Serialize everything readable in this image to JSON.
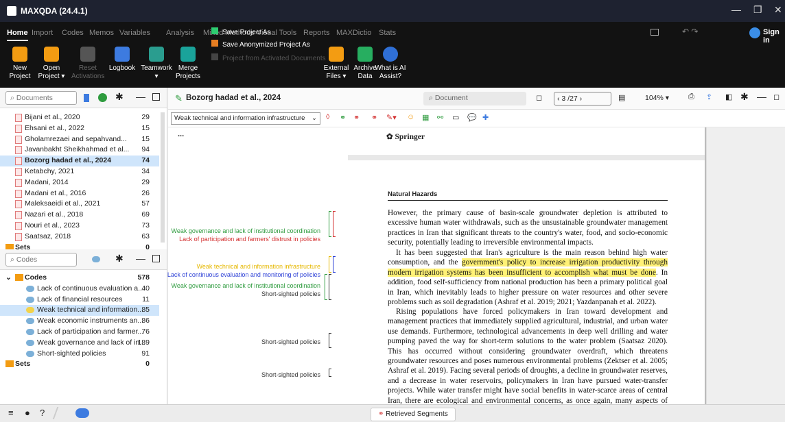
{
  "app": {
    "title": "MAXQDA (24.4.1)",
    "sign_in": "Sign in"
  },
  "menu_tabs": [
    "Home",
    "Import",
    "Codes",
    "Memos",
    "Variables",
    "Analysis",
    "Mixed Methods",
    "Visual Tools",
    "Reports",
    "MAXDictio",
    "Stats"
  ],
  "ribbon": {
    "new": "New\nProject",
    "open": "Open\nProject ▾",
    "reset": "Reset\nActivations",
    "logbook": "Logbook",
    "teamwork": "Teamwork\n▾",
    "merge": "Merge\nProjects",
    "save_as": "Save Project As",
    "save_anon": "Save Anonymized Project As",
    "from_activated": "Project from Activated Documents",
    "external": "External\nFiles ▾",
    "archive": "Archive\nData",
    "ai": "What is AI\nAssist?"
  },
  "documents": {
    "search_placeholder": "Documents",
    "items": [
      {
        "label": "Bijani et al., 2020",
        "count": "29"
      },
      {
        "label": "Ehsani et al., 2022",
        "count": "15"
      },
      {
        "label": "Gholamrezaei and sepahvand...",
        "count": "15"
      },
      {
        "label": "Javanbakht Sheikhahmad et al...",
        "count": "94"
      },
      {
        "label": "Bozorg hadad et al., 2024",
        "count": "74"
      },
      {
        "label": "Ketabchy, 2021",
        "count": "34"
      },
      {
        "label": "Madani, 2014",
        "count": "29"
      },
      {
        "label": "Madani et al., 2016",
        "count": "26"
      },
      {
        "label": "Maleksaeidi et al., 2021",
        "count": "57"
      },
      {
        "label": "Nazari et al., 2018",
        "count": "69"
      },
      {
        "label": "Nouri et al., 2023",
        "count": "73"
      },
      {
        "label": "Saatsaz, 2018",
        "count": "63"
      }
    ],
    "sets_label": "Sets",
    "sets_count": "0"
  },
  "codes": {
    "search_placeholder": "Codes",
    "root_label": "Codes",
    "root_count": "578",
    "items": [
      {
        "label": "Lack of continuous evaluation a...",
        "count": "40"
      },
      {
        "label": "Lack of financial resources",
        "count": "11"
      },
      {
        "label": "Weak technical and information...",
        "count": "85"
      },
      {
        "label": "Weak economic instruments an...",
        "count": "86"
      },
      {
        "label": "Lack of participation and farmer...",
        "count": "76"
      },
      {
        "label": "Weak governance and lack of in...",
        "count": "189"
      },
      {
        "label": "Short-sighted policies",
        "count": "91"
      }
    ],
    "sets_label": "Sets",
    "sets_count": "0"
  },
  "document_browser": {
    "title": "Bozorg hadad et al., 2024",
    "search_placeholder": "Document",
    "page_indicator": "3 /27",
    "zoom": "104% ▾",
    "code_dropdown": "Weak technical and information infrastructure",
    "ellipsis": "..."
  },
  "margin_codes": [
    {
      "label": "Weak governance and lack of institutional coordination",
      "color": "#2e9b3e"
    },
    {
      "label": "Lack of participation and farmers' distrust in policies",
      "color": "#d32f2f"
    },
    {
      "label": "Weak technical and information infrastructure",
      "color": "#e6b800"
    },
    {
      "label": "Lack of continuous evaluation and monitoring of policies",
      "color": "#2b3fd6"
    },
    {
      "label": "Weak governance and lack of institutional coordination",
      "color": "#2e9b3e"
    },
    {
      "label": "Short-sighted policies",
      "color": "#333333"
    },
    {
      "label": "Short-sighted policies",
      "color": "#333333"
    },
    {
      "label": "Short-sighted policies",
      "color": "#333333"
    }
  ],
  "page": {
    "publisher": "Springer",
    "journal": "Natural Hazards",
    "p1": "However, the primary cause of basin-scale groundwater depletion is attributed to excessive human water withdrawals, such as the unsustainable groundwater management practices in Iran that significant threats to the country's water, food, and socio-economic security, potentially leading to irreversible environmental impacts.",
    "p2a": "It has been suggested that Iran's agriculture is the main reason behind high water consumption, and the ",
    "p2hl": "government's policy to increase irrigation productivity through modern irrigation systems has been insufficient to accomplish what must be done",
    "p2b": ". In addition, food self-sufficiency from national production has been a primary political goal in Iran, which inevitably leads to higher pressure on water resources and other severe problems such as soil degradation (Ashraf et al. 2019; 2021; Yazdanpanah et al. 2022).",
    "p3": "Rising populations have forced policymakers in Iran toward development and management practices that immediately supplied agricultural, industrial, and urban water use demands. Furthermore, technological advancements in deep well drilling and water pumping paved the way for short-term solutions to the water problem (Saatsaz 2020). This has occurred without considering groundwater overdraft, which threatens groundwater resources and poses numerous environmental problems (Zektser et al. 2005; Ashraf et al. 2019). Facing several periods of droughts, a decline in groundwater reserves, and a decrease in water reservoirs, policymakers in Iran have pursued water-transfer projects. While water transfer might have social benefits in water-scarce areas of central Iran, there are ecological and environmental concerns, as once again, many aspects of these projects"
  },
  "status": {
    "retrieved": "Retrieved Segments"
  }
}
